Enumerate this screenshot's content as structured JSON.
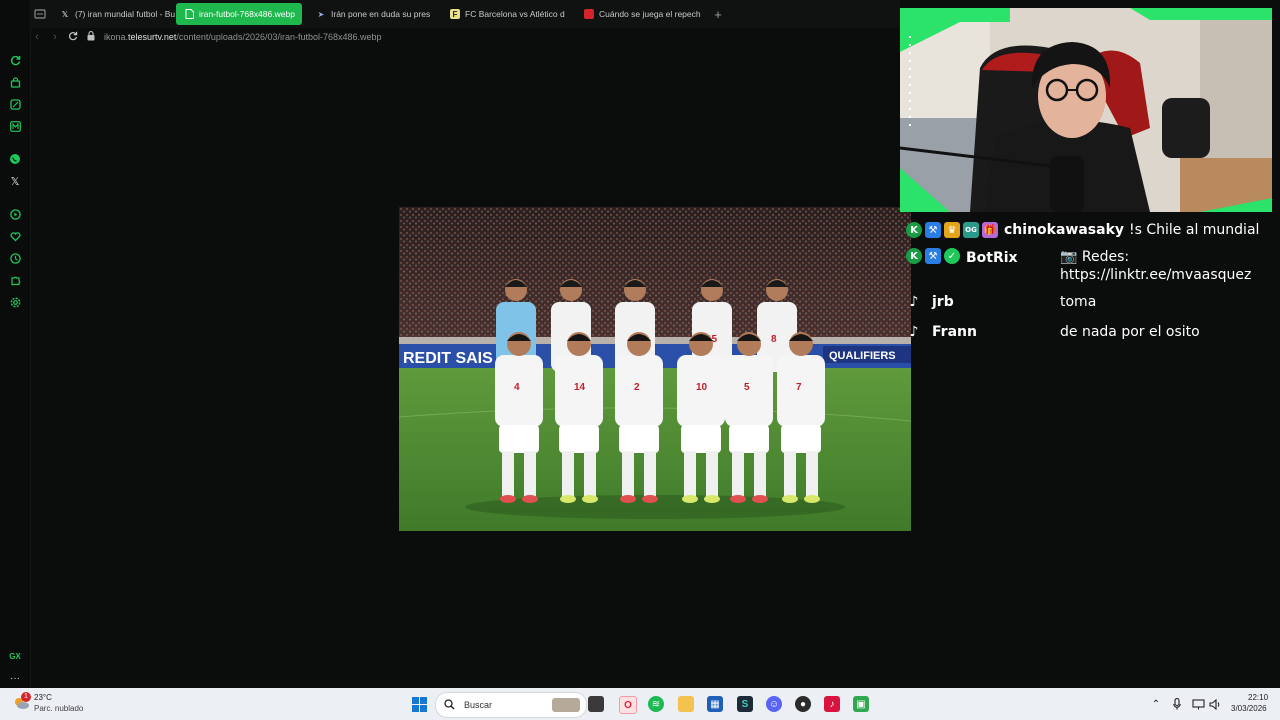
{
  "browser": {
    "tabs": [
      {
        "label": "(7) iran mundial futbol - Bu",
        "icon": "x-logo-icon",
        "active": false
      },
      {
        "label": "iran-futbol-768x486.webp",
        "icon": "file-icon",
        "active": true
      },
      {
        "label": "Irán pone en duda su pres",
        "icon": "news-icon",
        "active": false
      },
      {
        "label": "FC Barcelona vs Atlético d",
        "icon": "fc-icon",
        "active": false
      },
      {
        "label": "Cuándo se juega el repech",
        "icon": "news-red-icon",
        "active": false
      }
    ],
    "url_prefix": "ikona.",
    "url_domain": "telesurtv.net",
    "url_path": "/content/uploads/2026/03/iran-futbol-768x486.webp",
    "accent": "#1fb84d"
  },
  "sidebar": {
    "icons": [
      "refresh-icon",
      "bag-icon",
      "gamepad-icon",
      "m-icon",
      "whatsapp-icon",
      "x-logo-icon",
      "player-icon",
      "heart-icon",
      "clock-icon",
      "puzzle-icon",
      "settings-icon",
      "gx-icon",
      "more-icon"
    ],
    "gx_label": "GX"
  },
  "image": {
    "banner_left": "REDIT SAIS",
    "banner_right": "QUALIFIERS",
    "back_numbers": [
      "15",
      "8"
    ],
    "front_numbers": [
      "4",
      "14",
      "2",
      "10",
      "5",
      "7"
    ]
  },
  "chat": {
    "messages": [
      {
        "platform": "kick",
        "user": "chinokawasaky",
        "text": "!s Chile al mundial"
      },
      {
        "platform": "kick",
        "user": "BotRix",
        "text": "📷 Redes:",
        "text2": "https://linktr.ee/mvaasquez"
      },
      {
        "platform": "tiktok",
        "user": "jrb",
        "text": "toma"
      },
      {
        "platform": "tiktok",
        "user": "Frann",
        "text": "de nada por el osito"
      }
    ]
  },
  "taskbar": {
    "weather_temp": "23°C",
    "weather_desc": "Parc. nublado",
    "weather_badge": "1",
    "search_placeholder": "Buscar",
    "time": "22:10",
    "date": "3/03/2026"
  }
}
